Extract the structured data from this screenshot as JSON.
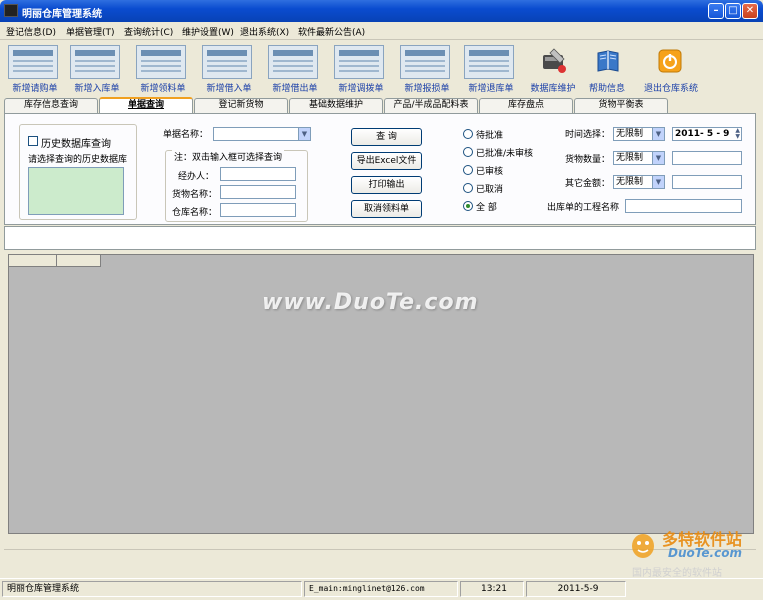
{
  "window": {
    "title": "明丽仓库管理系统"
  },
  "menu": [
    "登记信息(D)",
    "单据管理(T)",
    "查询统计(C)",
    "维护设置(W)",
    "退出系统(X)",
    "软件最新公告(A)"
  ],
  "toolbar": [
    "新增请购单",
    "新增入库单",
    "新增领料单",
    "新增借入单",
    "新增借出单",
    "新增调拨单",
    "新增报损单",
    "新增退库单",
    "数据库维护",
    "帮助信息",
    "退出仓库系统"
  ],
  "tabs": [
    "库存信息查询",
    "单据查询",
    "登记新货物",
    "基础数据维护",
    "产品/半成品配料表",
    "库存盘点",
    "货物平衡表"
  ],
  "history": {
    "checkbox_label": "历史数据库查询",
    "list_label": "请选择查询的历史数据库"
  },
  "form": {
    "doc_name_label": "单据名称：",
    "note": "注：双击输入框可选择查询",
    "handler_label": "经办人：",
    "goods_label": "货物名称：",
    "warehouse_label": "仓库名称："
  },
  "buttons": [
    "查  询",
    "导出Excel文件",
    "打印输出",
    "取消领料单"
  ],
  "status_radios": [
    {
      "label": "待批准",
      "checked": false
    },
    {
      "label": "已批准/未审核",
      "checked": false
    },
    {
      "label": "已审核",
      "checked": false
    },
    {
      "label": "已取消",
      "checked": false
    },
    {
      "label": "全  部",
      "checked": true
    }
  ],
  "filters": {
    "time_label": "时间选择：",
    "time_value": "无限制",
    "date_value": "2011- 5 - 9",
    "qty_label": "货物数量：",
    "qty_value": "无限制",
    "amount_label": "其它金额：",
    "amount_value": "无限制",
    "project_label": "出库单的工程名称"
  },
  "status": {
    "app": "明丽仓库管理系统",
    "email": "E_main:minglinet@126.com",
    "time": "13:21",
    "date": "2011-5-9"
  },
  "watermark": "www.DuoTe.com",
  "brand": {
    "name": "多特软件站",
    "url": "DuoTe.com",
    "slogan": "国内最安全的软件站"
  },
  "colors": {
    "titlebar": "#0a4ccf",
    "toolbar_label": "#1a3fa8",
    "list_bg": "#ccebcc",
    "tab_active_border": "#f0a020"
  }
}
